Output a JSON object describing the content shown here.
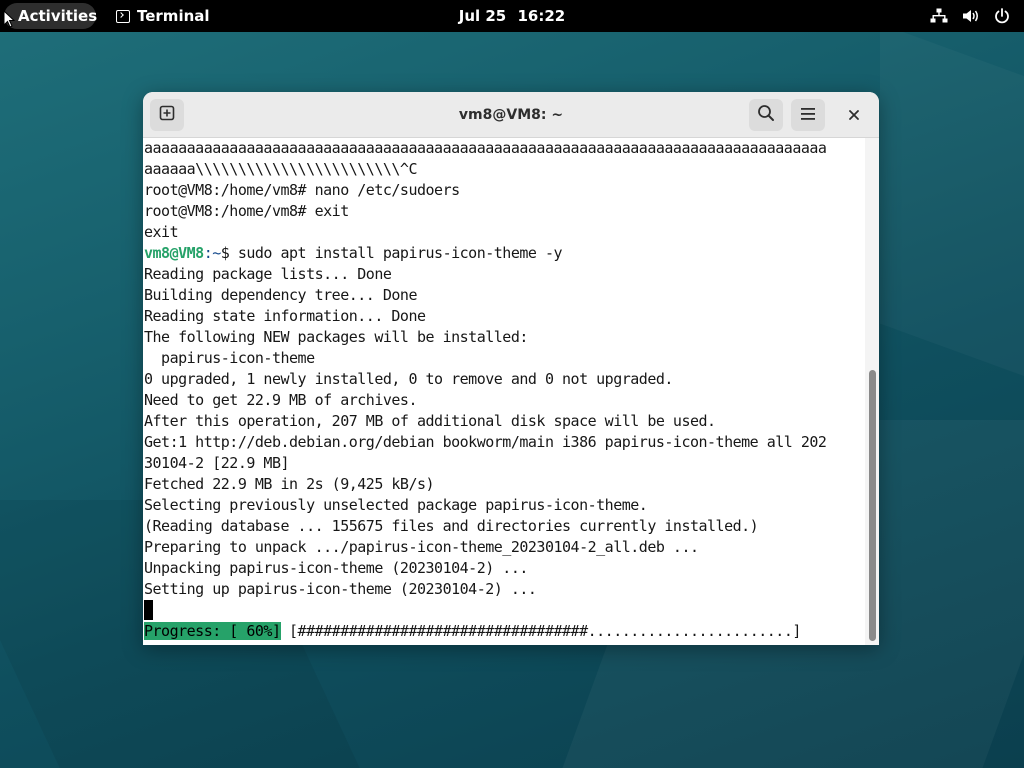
{
  "topbar": {
    "activities_label": "Activities",
    "app_name": "Terminal",
    "app_icon": "terminal-icon",
    "date": "Jul 25",
    "time": "16:22",
    "tray_icons": [
      "network-icon",
      "volume-icon",
      "power-icon"
    ]
  },
  "window": {
    "title": "vm8@VM8: ~",
    "new_tab_icon": "new-tab-icon",
    "search_icon": "search-icon",
    "menu_icon": "hamburger-menu-icon",
    "close_icon": "close-icon"
  },
  "terminal": {
    "lines": [
      "aaaaaaaaaaaaaaaaaaaaaaaaaaaaaaaaaaaaaaaaaaaaaaaaaaaaaaaaaaaaaaaaaaaaaaaaaaaaaaaa",
      "aaaaaa\\\\\\\\\\\\\\\\\\\\\\\\\\\\\\\\\\\\\\\\\\\\\\\\^C",
      "root@VM8:/home/vm8# nano /etc/sudoers",
      "root@VM8:/home/vm8# exit",
      "exit",
      "__PROMPT__",
      "Reading package lists... Done",
      "Building dependency tree... Done",
      "Reading state information... Done",
      "The following NEW packages will be installed:",
      "  papirus-icon-theme",
      "0 upgraded, 1 newly installed, 0 to remove and 0 not upgraded.",
      "Need to get 22.9 MB of archives.",
      "After this operation, 207 MB of additional disk space will be used.",
      "Get:1 http://deb.debian.org/debian bookworm/main i386 papirus-icon-theme all 202",
      "30104-2 [22.9 MB]",
      "Fetched 22.9 MB in 2s (9,425 kB/s)",
      "Selecting previously unselected package papirus-icon-theme.",
      "(Reading database ... 155675 files and directories currently installed.)",
      "Preparing to unpack .../papirus-icon-theme_20230104-2_all.deb ...",
      "Unpacking papirus-icon-theme (20230104-2) ...",
      "Setting up papirus-icon-theme (20230104-2) ..."
    ],
    "prompt": {
      "user_host": "vm8@VM8",
      "path": ":~",
      "symbol": "$",
      "command": " sudo apt install papirus-icon-theme -y"
    },
    "progress": {
      "label": "Progress: [ 60%]",
      "bar": " [##################################........................]",
      "percent": 60
    },
    "colors": {
      "prompt_user": "#26a269",
      "progress_bg": "#26a269"
    }
  },
  "scrollbar": {
    "position_fraction": 0.45,
    "visible_fraction": 0.55
  }
}
